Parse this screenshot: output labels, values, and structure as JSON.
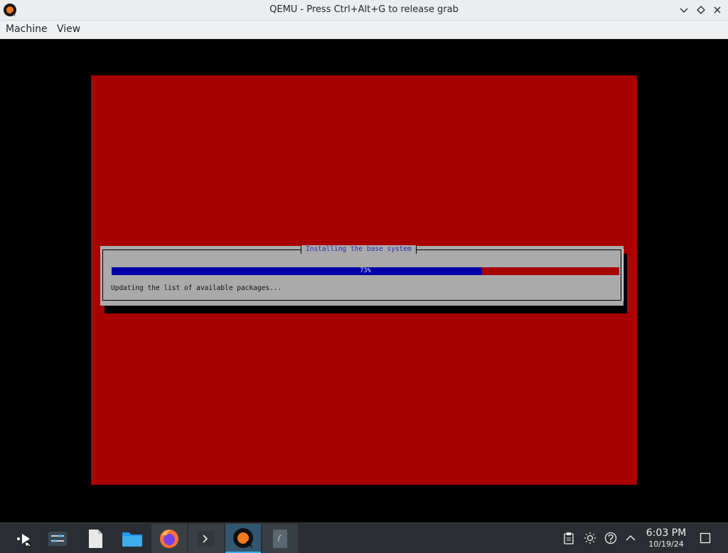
{
  "window": {
    "title": "QEMU - Press Ctrl+Alt+G to release grab"
  },
  "menu": [
    "Machine",
    "View"
  ],
  "installer": {
    "dialog_title": "Installing the base system",
    "progress_percent": 73,
    "progress_label": "73%",
    "status": "Updating the list of available packages..."
  },
  "colors": {
    "screen_background": "#a80000",
    "dialog_background": "#aaaaaa",
    "progress_fill": "#0000a8",
    "taskbar": "#2a2e32"
  },
  "taskbar": {
    "items": [
      {
        "name": "application-launcher-icon",
        "state": "normal"
      },
      {
        "name": "system-settings-icon",
        "state": "normal"
      },
      {
        "name": "text-document-icon",
        "state": "normal"
      },
      {
        "name": "folder-icon",
        "state": "normal"
      },
      {
        "name": "firefox-icon",
        "state": "open"
      },
      {
        "name": "terminal-icon",
        "state": "open"
      },
      {
        "name": "qemu-icon",
        "state": "active"
      },
      {
        "name": "document-viewer-icon",
        "state": "open"
      }
    ],
    "tray": [
      "clipboard-icon",
      "brightness-icon",
      "network-icon",
      "expand-tray-icon"
    ],
    "clock": {
      "time": "6:03 PM",
      "date": "10/19/24"
    }
  }
}
